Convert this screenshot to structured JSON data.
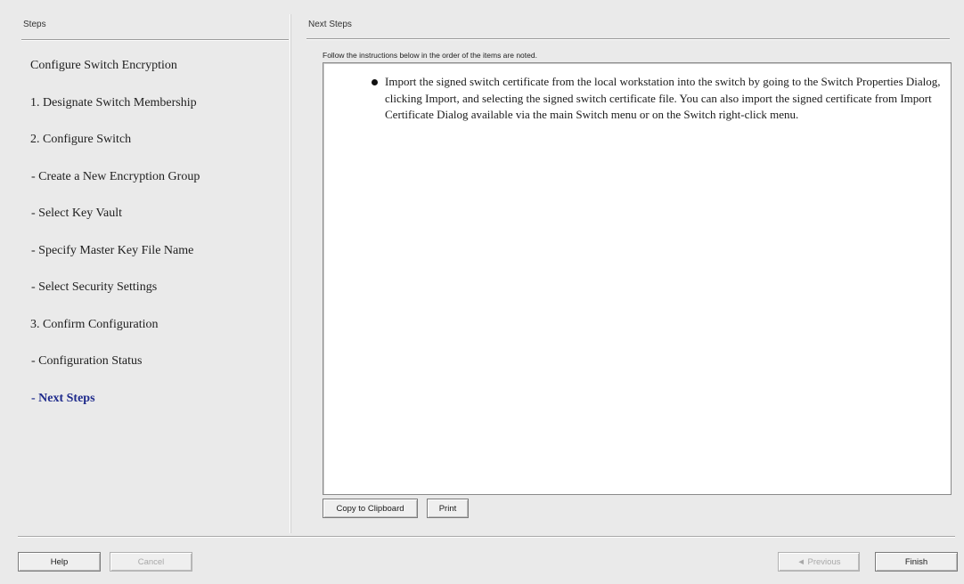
{
  "steps_panel": {
    "header": "Steps",
    "items": [
      {
        "label": "Configure Switch Encryption",
        "active": false
      },
      {
        "label": "1. Designate Switch Membership",
        "active": false
      },
      {
        "label": "2. Configure Switch",
        "active": false
      },
      {
        "label": "- Create a New Encryption Group",
        "active": false
      },
      {
        "label": "- Select Key Vault",
        "active": false
      },
      {
        "label": "- Specify Master Key File Name",
        "active": false
      },
      {
        "label": "- Select Security Settings",
        "active": false
      },
      {
        "label": "3. Confirm Configuration",
        "active": false
      },
      {
        "label": "- Configuration Status",
        "active": false
      },
      {
        "label": "- Next Steps",
        "active": true
      }
    ]
  },
  "content": {
    "header": "Next Steps",
    "instructions": "Follow the instructions below in the order of the items are noted.",
    "bullet": "Import the signed switch certificate from the local workstation into the switch by going to the Switch Properties Dialog, clicking Import, and selecting the signed switch certificate file. You can also import the signed certificate from Import Certificate Dialog available via the main Switch menu or on the Switch right-click menu.",
    "copy_button": "Copy to Clipboard",
    "print_button": "Print"
  },
  "footer": {
    "help_button": "Help",
    "cancel_button": "Cancel",
    "previous_button": "◄ Previous",
    "finish_button": "Finish"
  },
  "colors": {
    "active_step": "#1f2b8c",
    "disabled_text": "#a8a8a8"
  }
}
